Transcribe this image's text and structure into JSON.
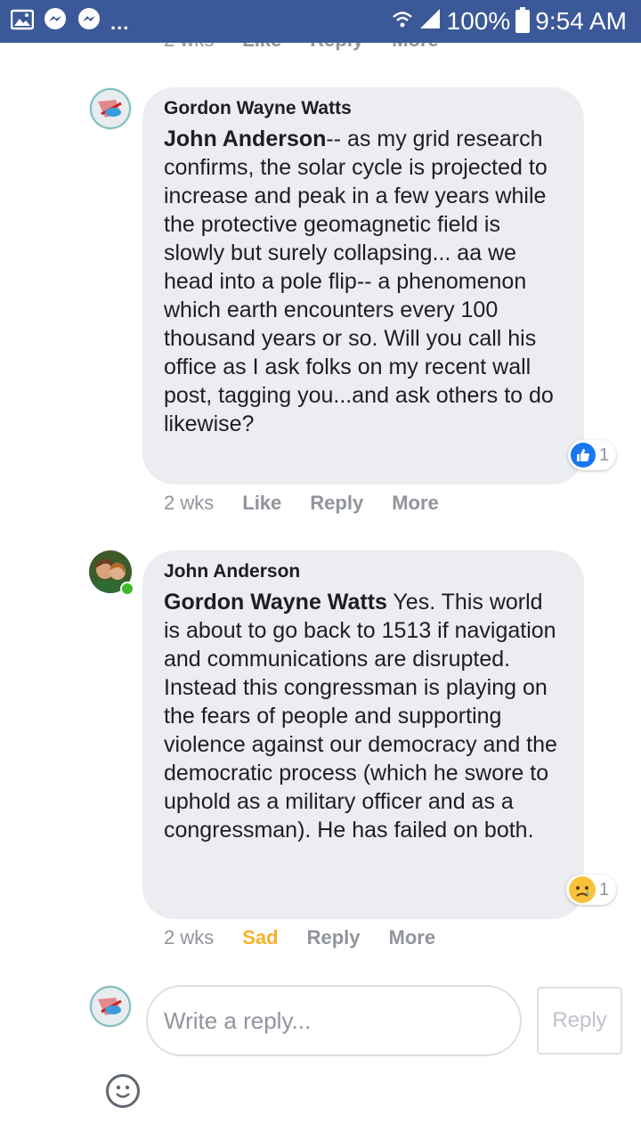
{
  "status_bar": {
    "notifications_more": "...",
    "battery": "100%",
    "time": "9:54 AM"
  },
  "top_actions": {
    "time": "2 wks",
    "like": "Like",
    "reply": "Reply",
    "more": "More"
  },
  "comments": [
    {
      "author": "Gordon Wayne Watts",
      "mention": "John Anderson",
      "text": "-- as my grid research confirms, the solar cycle is projected to increase and peak in a few years while the protective geomagnetic field is slowly but surely collapsing... aa we head into a pole flip-- a phenomenon which earth encounters every 100 thousand years or so. Will you call his office as I ask folks on my recent wall post, tagging you...and ask others to do likewise?",
      "reaction_icon": "like-icon",
      "reaction_count": "1",
      "time": "2 wks",
      "action_1": "Like",
      "reply": "Reply",
      "more": "More"
    },
    {
      "author": "John Anderson",
      "mention": "Gordon Wayne Watts",
      "text": " Yes. This world is about to go back to 1513 if navigation and communications are disrupted. Instead this congressman is playing on the fears of people and supporting violence against our democracy and the democratic process (which he swore to uphold as a military officer and as a congressman). He has failed on both.",
      "reaction_icon": "sad-icon",
      "reaction_count": "1",
      "time": "2 wks",
      "action_1": "Sad",
      "reply": "Reply",
      "more": "More"
    }
  ],
  "composer": {
    "placeholder": "Write a reply...",
    "reply_button": "Reply"
  },
  "colors": {
    "status_bar": "#3b5998",
    "bubble": "#ebedf0",
    "sad_accent": "#f7b125",
    "like_blue": "#1877f2"
  }
}
